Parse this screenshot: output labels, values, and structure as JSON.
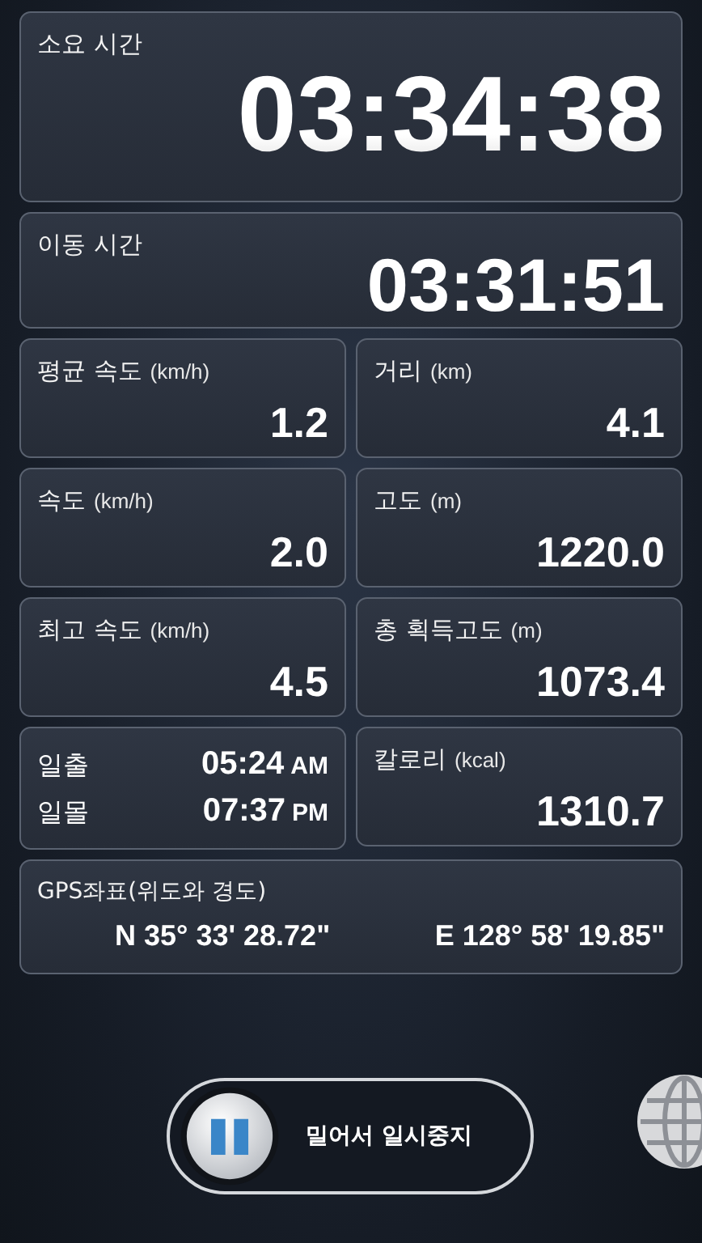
{
  "elapsed": {
    "label": "소요 시간",
    "value": "03:34:38"
  },
  "moving": {
    "label": "이동 시간",
    "value": "03:31:51"
  },
  "stats": [
    {
      "kind": "stat",
      "label": "평균 속도",
      "unit": "(km/h)",
      "value": "1.2"
    },
    {
      "kind": "stat",
      "label": "거리",
      "unit": "(km)",
      "value": "4.1"
    },
    {
      "kind": "stat",
      "label": "속도",
      "unit": "(km/h)",
      "value": "2.0"
    },
    {
      "kind": "stat",
      "label": "고도",
      "unit": "(m)",
      "value": "1220.0"
    },
    {
      "kind": "stat",
      "label": "최고 속도",
      "unit": "(km/h)",
      "value": "4.5"
    },
    {
      "kind": "stat",
      "label": "총 획득고도",
      "unit": "(m)",
      "value": "1073.4"
    },
    {
      "kind": "sun",
      "rows": [
        {
          "label": "일출",
          "time": "05:24",
          "suffix": "AM"
        },
        {
          "label": "일몰",
          "time": "07:37",
          "suffix": "PM"
        }
      ]
    },
    {
      "kind": "stat",
      "label": "칼로리",
      "unit": "(kcal)",
      "value": "1310.7"
    }
  ],
  "gps": {
    "label": "GPS좌표(위도와 경도)",
    "latitude": "N 35° 33' 28.72\"",
    "longitude": "E 128° 58' 19.85\""
  },
  "slider": {
    "label": "밀어서 일시중지",
    "level": 0
  }
}
